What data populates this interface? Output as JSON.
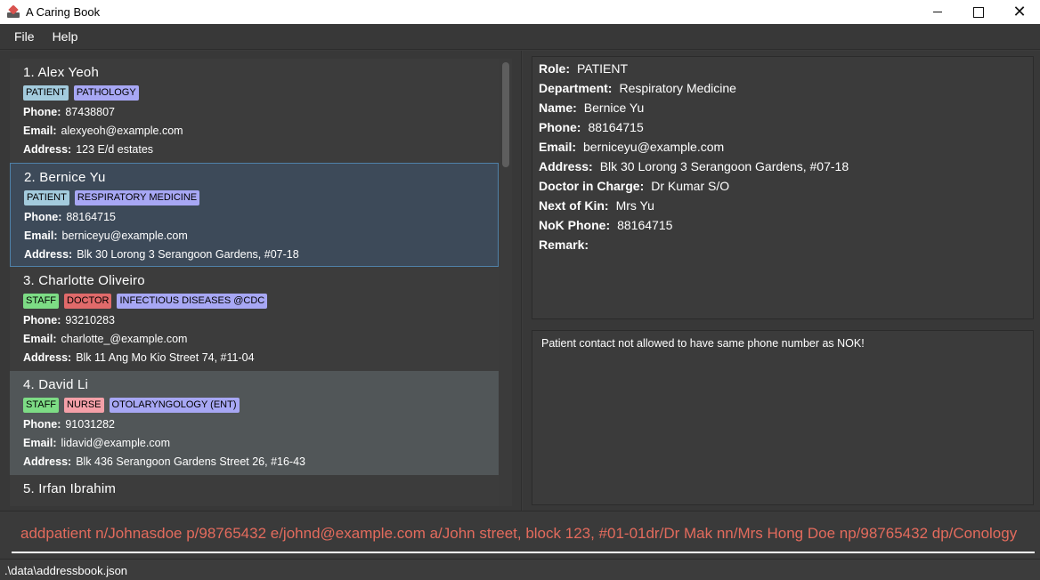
{
  "window": {
    "title": "A Caring Book"
  },
  "menu": {
    "file": "File",
    "help": "Help"
  },
  "persons": [
    {
      "name": "1. Alex Yeoh",
      "tags": [
        {
          "text": "PATIENT",
          "kind": "patient"
        },
        {
          "text": "PATHOLOGY",
          "kind": "dept"
        }
      ],
      "phone": "87438807",
      "email": "alexyeoh@example.com",
      "address": "123 E/d estates"
    },
    {
      "name": "2. Bernice Yu",
      "tags": [
        {
          "text": "PATIENT",
          "kind": "patient"
        },
        {
          "text": "RESPIRATORY MEDICINE",
          "kind": "dept"
        }
      ],
      "phone": "88164715",
      "email": "berniceyu@example.com",
      "address": "Blk 30 Lorong 3 Serangoon Gardens, #07-18"
    },
    {
      "name": "3. Charlotte Oliveiro",
      "tags": [
        {
          "text": "STAFF",
          "kind": "staff"
        },
        {
          "text": "DOCTOR",
          "kind": "doctor"
        },
        {
          "text": "INFECTIOUS DISEASES @CDC",
          "kind": "dept"
        }
      ],
      "phone": "93210283",
      "email": "charlotte_@example.com",
      "address": "Blk 11 Ang Mo Kio Street 74, #11-04"
    },
    {
      "name": "4. David Li",
      "tags": [
        {
          "text": "STAFF",
          "kind": "staff"
        },
        {
          "text": "NURSE",
          "kind": "nurse"
        },
        {
          "text": "OTOLARYNGOLOGY (ENT)",
          "kind": "dept"
        }
      ],
      "phone": "91031282",
      "email": "lidavid@example.com",
      "address": "Blk 436 Serangoon Gardens Street 26, #16-43"
    },
    {
      "name": "5. Irfan Ibrahim",
      "tags": [],
      "phone": "",
      "email": "",
      "address": ""
    }
  ],
  "labels": {
    "phone": "Phone:",
    "email": "Email:",
    "address": "Address:"
  },
  "selected_index": 1,
  "detail": {
    "role_label": "Role:",
    "role": "PATIENT",
    "department_label": "Department:",
    "department": "Respiratory Medicine",
    "name_label": "Name:",
    "name": "Bernice Yu",
    "phone_label": "Phone:",
    "phone": "88164715",
    "email_label": "Email:",
    "email": "berniceyu@example.com",
    "address_label": "Address:",
    "address": "Blk 30 Lorong 3 Serangoon Gardens, #07-18",
    "doctor_label": "Doctor in Charge:",
    "doctor": "Dr Kumar S/O",
    "nok_label": "Next of Kin:",
    "nok": "Mrs Yu",
    "nok_phone_label": "NoK Phone:",
    "nok_phone": "88164715",
    "remark_label": "Remark:",
    "remark": ""
  },
  "result": "Patient contact not allowed to have same phone number as NOK!",
  "command": {
    "value": "addpatient n/Johnasdoe p/98765432 e/johnd@example.com a/John street, block 123, #01-01dr/Dr Mak nn/Mrs Hong Doe np/98765432 dp/Conology"
  },
  "status": {
    "path": ".\\data\\addressbook.json"
  }
}
